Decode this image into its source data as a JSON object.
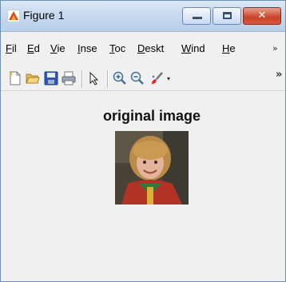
{
  "window": {
    "title": "Figure 1"
  },
  "titlebar_buttons": {
    "minimize_icon": "minimize-icon",
    "maximize_icon": "maximize-icon",
    "close_icon": "close-icon",
    "close_glyph": "✕"
  },
  "menu": {
    "items": [
      {
        "underline": "F",
        "rest": "il"
      },
      {
        "underline": "E",
        "rest": "d"
      },
      {
        "underline": "V",
        "rest": "ie"
      },
      {
        "underline": "I",
        "rest": "nse"
      },
      {
        "underline": "T",
        "rest": "oc"
      },
      {
        "underline": "D",
        "rest": "eskt"
      },
      {
        "underline": "W",
        "rest": "ind"
      },
      {
        "underline": "H",
        "rest": "e"
      }
    ],
    "overflow_icon": "chevron-overflow-icon",
    "overflow_glyph": "»"
  },
  "toolbar": {
    "icons": [
      "new-figure-icon",
      "open-file-icon",
      "save-icon",
      "print-icon",
      "select-arrow-icon",
      "zoom-in-icon",
      "zoom-out-icon",
      "brush-icon"
    ],
    "dropdown_glyph": "▾",
    "more_glyph": "»"
  },
  "figure": {
    "axes_title": "original image",
    "image": "portrait-photo"
  },
  "colors": {
    "titlebar": "#c6d9ef",
    "close_button": "#c8432a",
    "window_bg": "#f0f0f0"
  }
}
